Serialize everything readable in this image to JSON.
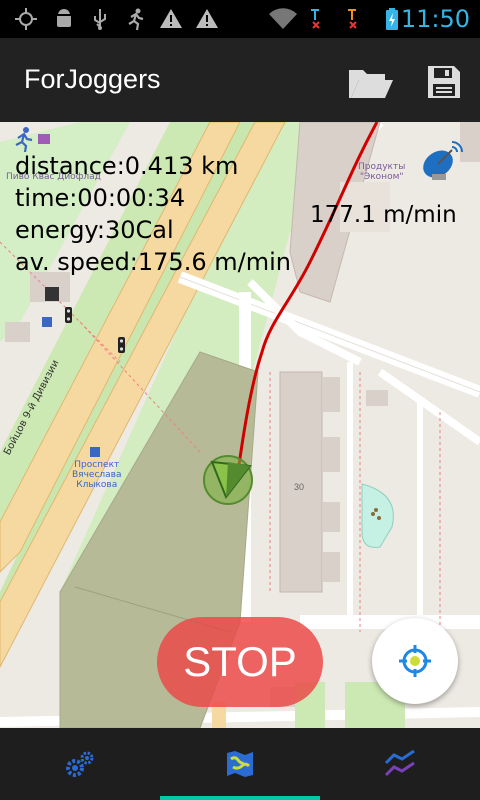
{
  "status_bar": {
    "time": "11:50",
    "icons": [
      "gps-icon",
      "android-debug-icon",
      "usb-icon",
      "runner-icon",
      "warning-icon",
      "warning-icon",
      "wifi-icon",
      "sim1-no-signal-icon",
      "sim2-no-signal-icon",
      "battery-charging-icon"
    ],
    "accent_color": "#33b5e5"
  },
  "app_bar": {
    "title": "ForJoggers",
    "open_icon": "folder-open-icon",
    "save_icon": "save-icon"
  },
  "stats": {
    "distance": "distance:0.413 km",
    "time": "time:00:00:34",
    "energy": "energy:30Cal",
    "avg_speed": "av. speed:175.6 m/min",
    "current_speed": "177.1 m/min"
  },
  "map_labels": {
    "poi_beer": "Пиво Квас\nДиофлад",
    "poi_products_1": "Продукты",
    "poi_products_2": "\"Эконом\"",
    "bus_stop_1": "Проспект",
    "bus_stop_2": "Вячеслава",
    "bus_stop_3": "Клыкова",
    "street": "Бойцов 9-й Дивизии",
    "house_number": "30"
  },
  "controls": {
    "stop_label": "STOP",
    "stop_color": "#eb4646",
    "locate_icon": "crosshair-icon"
  },
  "bottom_tabs": [
    {
      "icon": "settings-gears-icon",
      "active": false
    },
    {
      "icon": "map-icon",
      "active": true
    },
    {
      "icon": "chart-line-icon",
      "active": false
    }
  ],
  "active_tab_color": "#00c8a8"
}
